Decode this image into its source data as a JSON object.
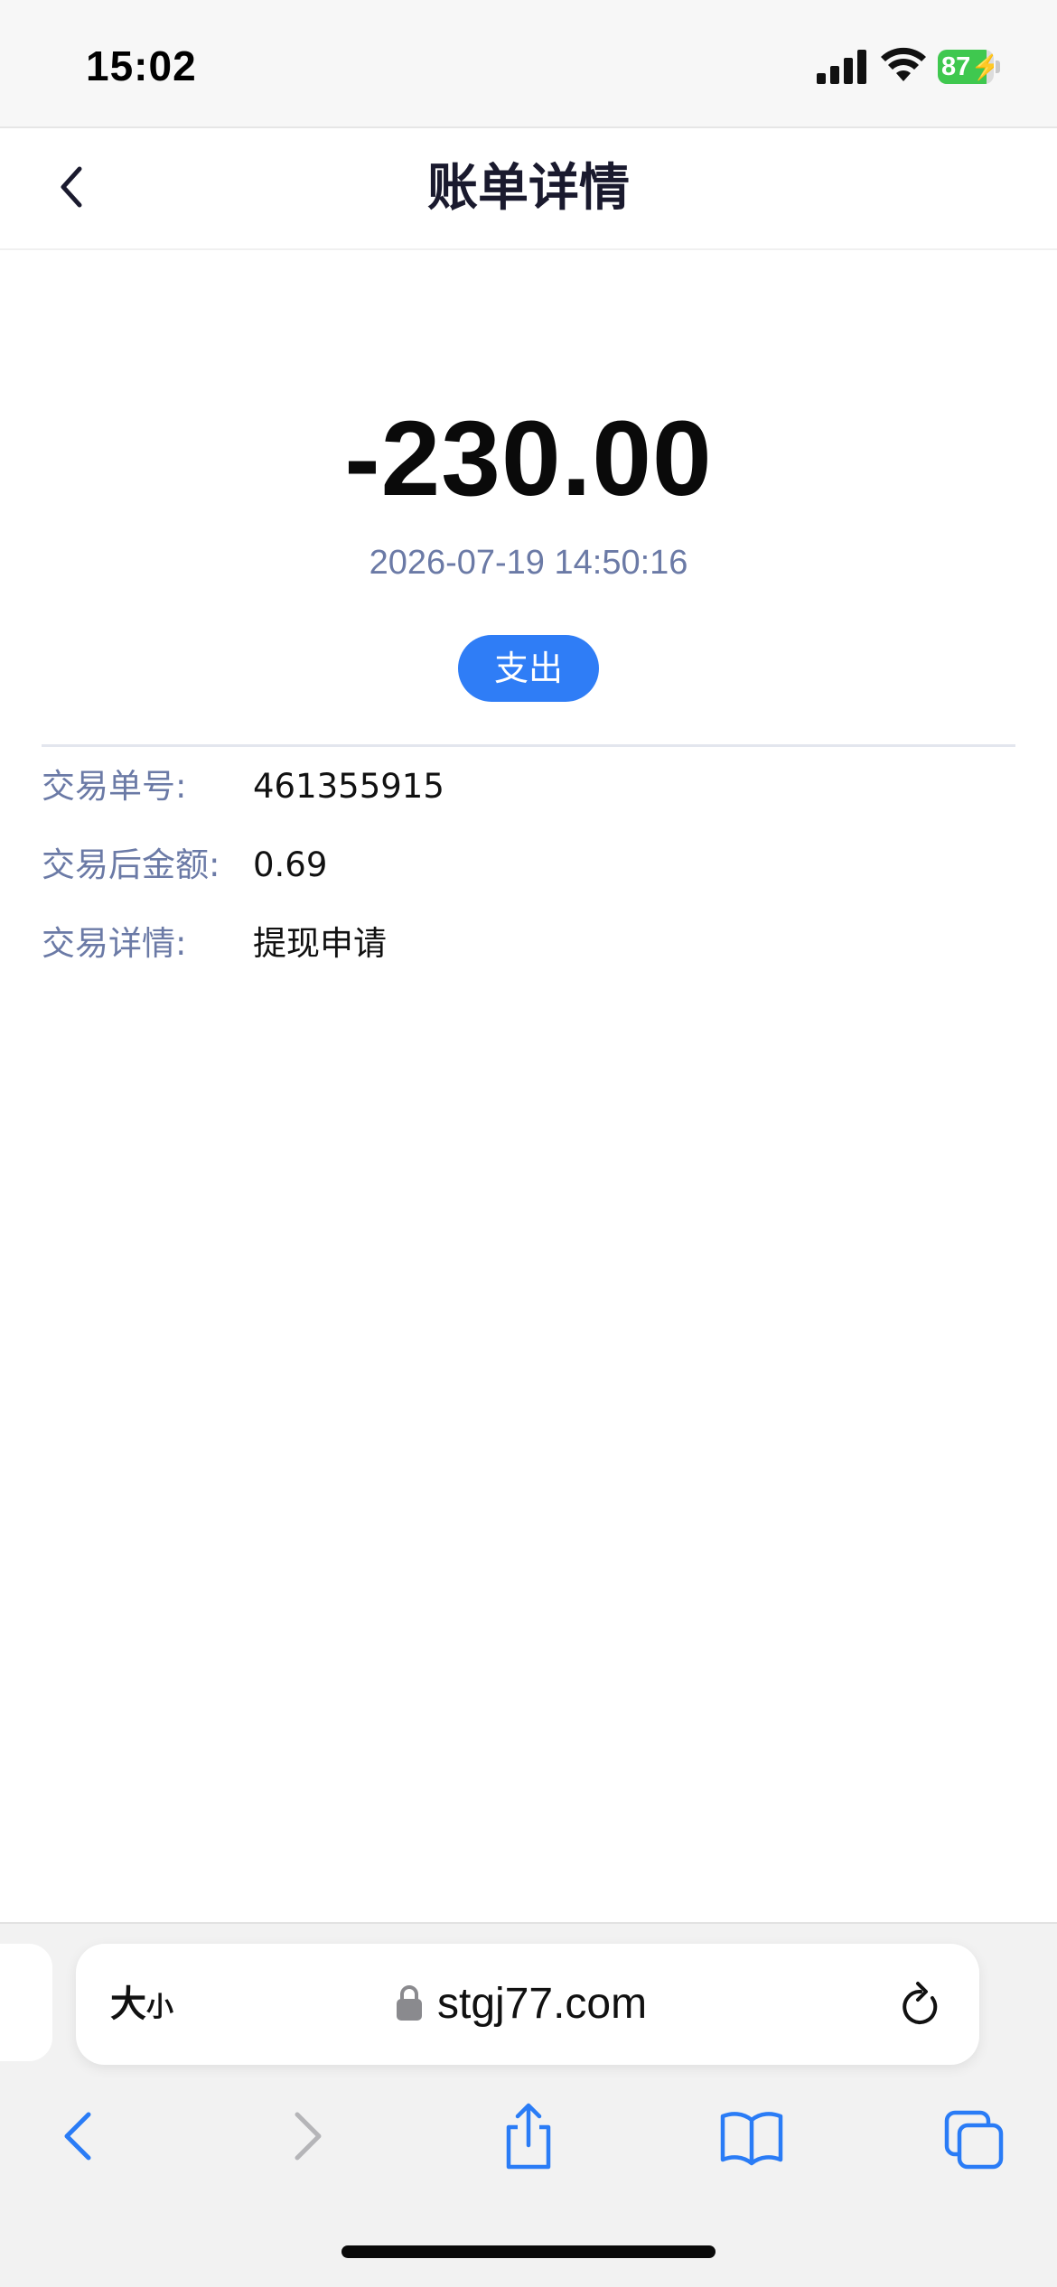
{
  "status_bar": {
    "time": "15:02",
    "battery_percent": 87,
    "battery_label": "87"
  },
  "header": {
    "title": "账单详情",
    "back_icon": "chevron-left-icon"
  },
  "transaction": {
    "amount": "-230.00",
    "datetime": "2026-07-19 14:50:16",
    "type_badge": "支出"
  },
  "details": [
    {
      "label": "交易单号:",
      "value": "461355915"
    },
    {
      "label": "交易后金额:",
      "value": "0.69"
    },
    {
      "label": "交易详情:",
      "value": "提现申请"
    }
  ],
  "browser": {
    "text_size_large": "大",
    "text_size_small": "小",
    "url": "stgj77.com",
    "icons": [
      "lock-icon",
      "reload-icon",
      "back-arrow-icon",
      "forward-arrow-icon",
      "share-icon",
      "bookmarks-icon",
      "tabs-icon"
    ]
  },
  "colors": {
    "accent": "#2f7df6",
    "label": "#6b7aa6",
    "battery": "#3fc84f",
    "safari_blue": "#2a7cf6"
  }
}
